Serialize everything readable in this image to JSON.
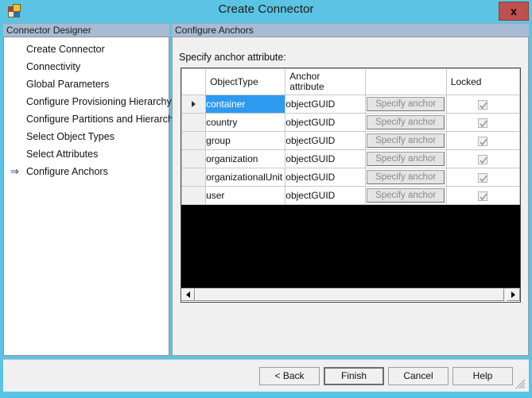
{
  "window": {
    "title": "Create Connector",
    "icon": "connector-app-icon",
    "close_label": "x"
  },
  "left_panel": {
    "header": "Connector Designer",
    "items": [
      {
        "label": "Create Connector",
        "current": false
      },
      {
        "label": "Connectivity",
        "current": false
      },
      {
        "label": "Global Parameters",
        "current": false
      },
      {
        "label": "Configure Provisioning Hierarchy",
        "current": false
      },
      {
        "label": "Configure Partitions and Hierarchies",
        "current": false
      },
      {
        "label": "Select Object Types",
        "current": false
      },
      {
        "label": "Select Attributes",
        "current": false
      },
      {
        "label": "Configure Anchors",
        "current": true
      }
    ],
    "current_marker": "⇒"
  },
  "right_panel": {
    "header": "Configure Anchors",
    "instruction": "Specify anchor attribute:",
    "table": {
      "columns": [
        "",
        "ObjectType",
        "Anchor attribute",
        "",
        "Locked"
      ],
      "anchor_header_line1": "Anchor",
      "anchor_header_line2": "attribute",
      "rows": [
        {
          "selected": true,
          "object_type": "container",
          "anchor_attribute": "objectGUID",
          "button": "Specify anchor",
          "locked": true
        },
        {
          "selected": false,
          "object_type": "country",
          "anchor_attribute": "objectGUID",
          "button": "Specify anchor",
          "locked": true
        },
        {
          "selected": false,
          "object_type": "group",
          "anchor_attribute": "objectGUID",
          "button": "Specify anchor",
          "locked": true
        },
        {
          "selected": false,
          "object_type": "organization",
          "anchor_attribute": "objectGUID",
          "button": "Specify anchor",
          "locked": true
        },
        {
          "selected": false,
          "object_type": "organizationalUnit",
          "anchor_attribute": "objectGUID",
          "button": "Specify anchor",
          "locked": true
        },
        {
          "selected": false,
          "object_type": "user",
          "anchor_attribute": "objectGUID",
          "button": "Specify anchor",
          "locked": true
        }
      ]
    },
    "scrollbar": {
      "left_arrow": "◄",
      "right_arrow": "►"
    }
  },
  "footer": {
    "buttons": [
      {
        "label": "< Back",
        "default": false
      },
      {
        "label": "Finish",
        "default": true
      },
      {
        "label": "Cancel",
        "default": false
      },
      {
        "label": "Help",
        "default": false
      }
    ]
  },
  "colors": {
    "titlebar": "#5BC4E4",
    "panel_header": "#A7BCD4",
    "selection": "#2E9AEF",
    "close_button": "#C0504D",
    "control_face": "#F0F0F0"
  }
}
